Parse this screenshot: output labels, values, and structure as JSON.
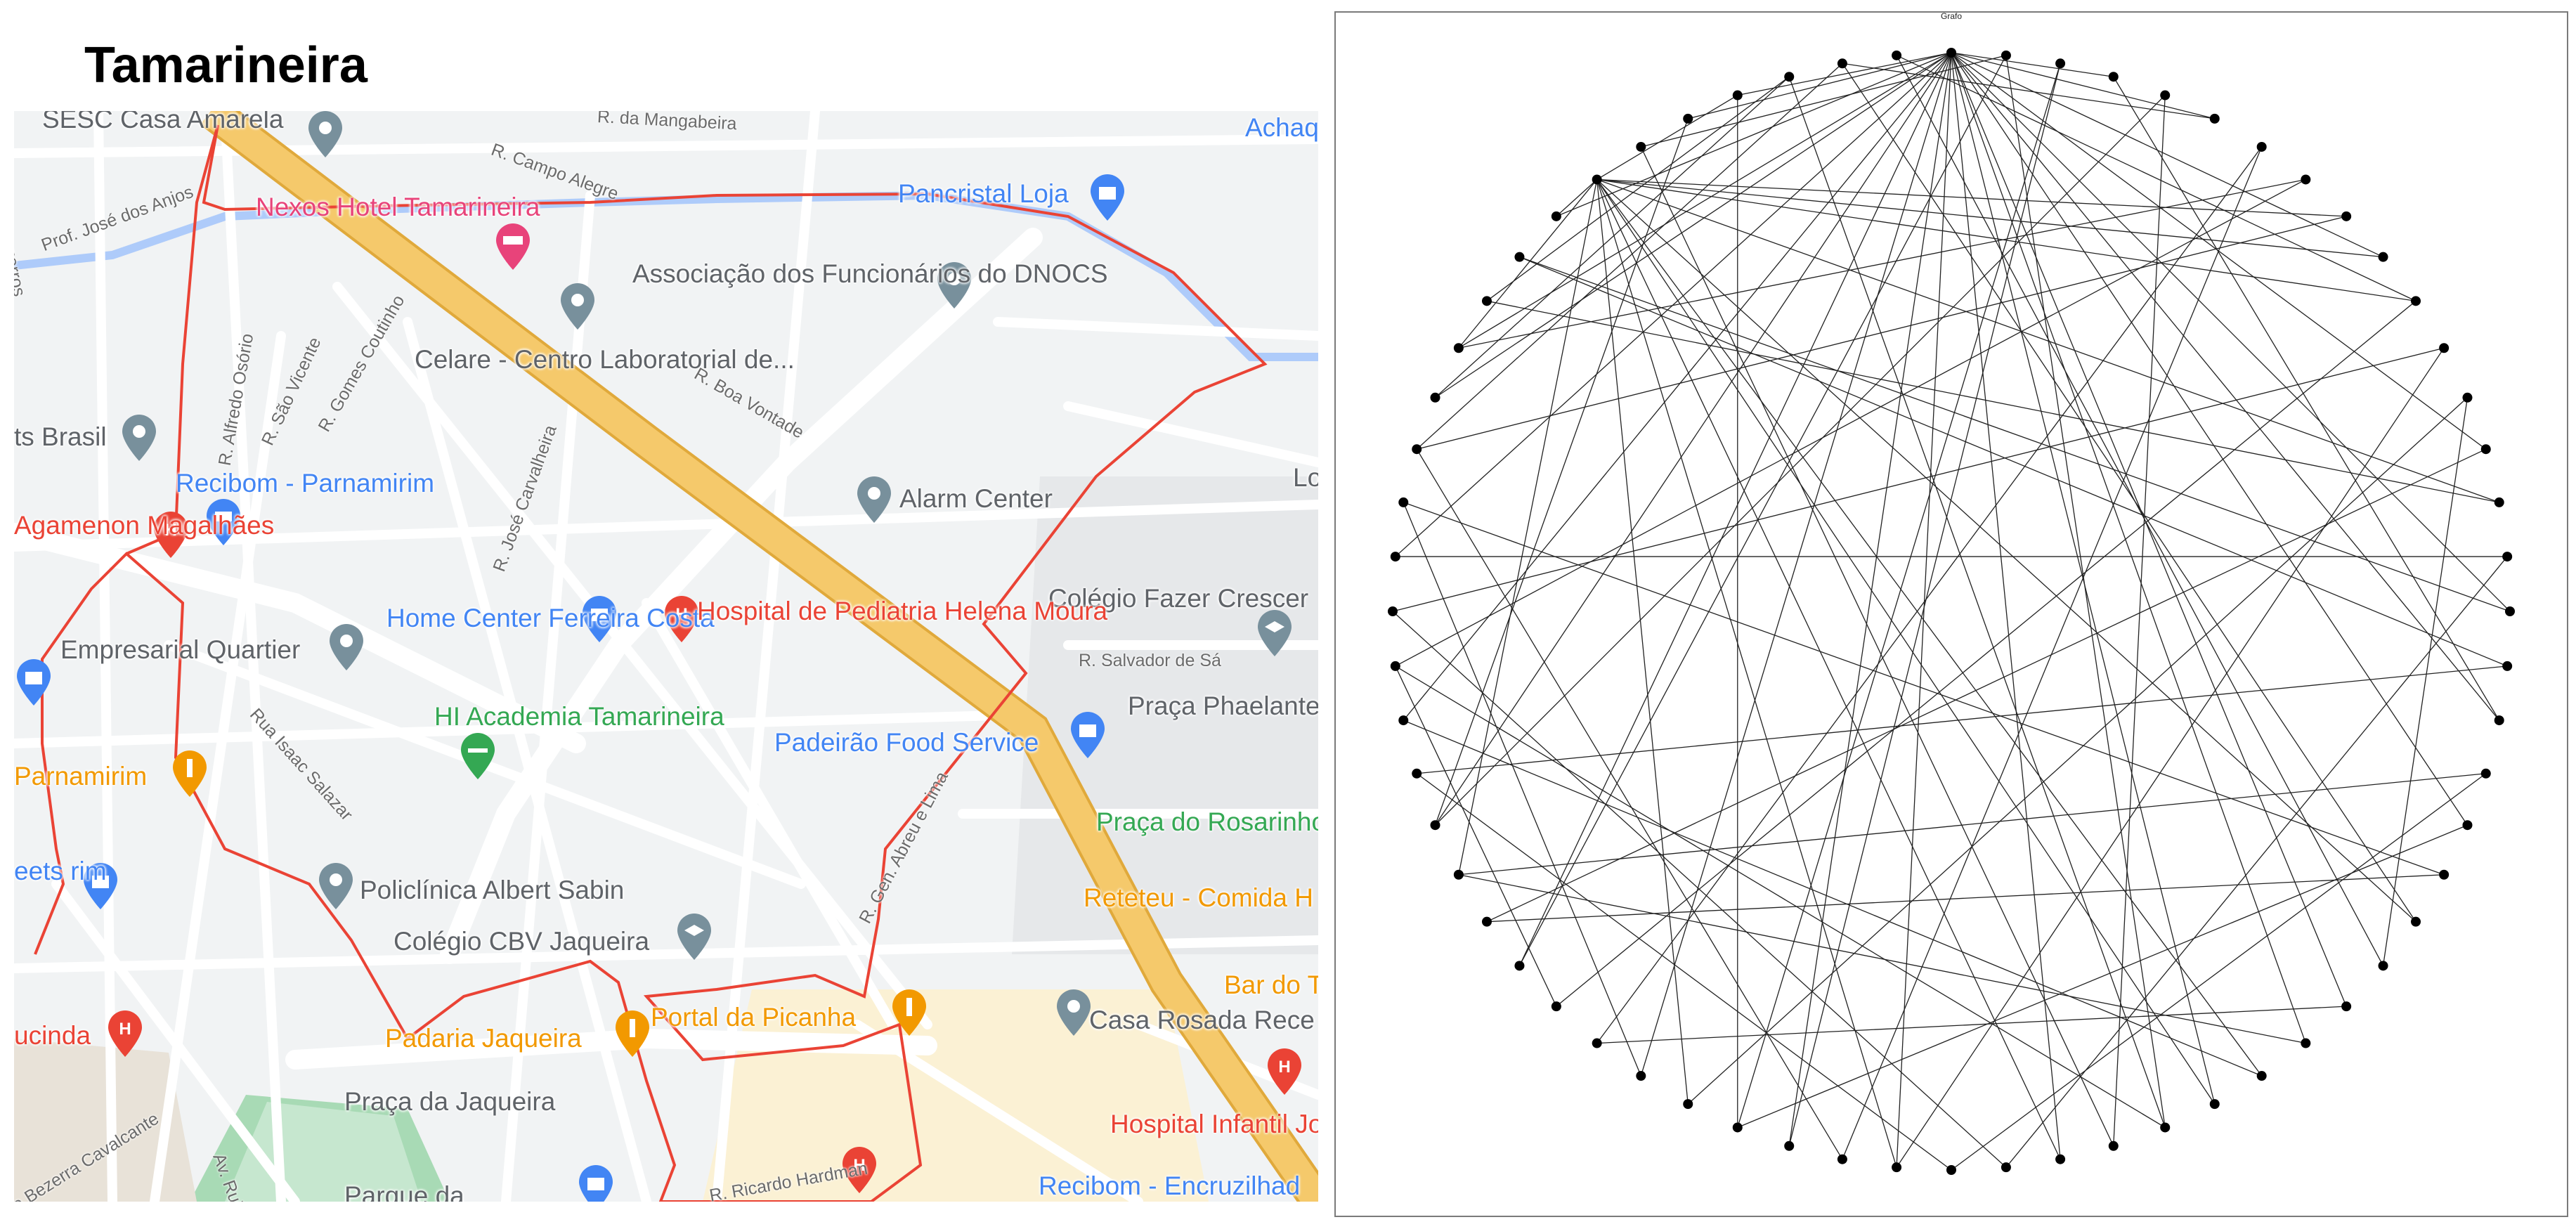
{
  "map": {
    "title": "Tamarineira",
    "colors": {
      "background": "#f1f3f4",
      "road": "#ffffff",
      "highway": "#f5c96b",
      "highway_edge": "#e0a93b",
      "river": "#aecbfa",
      "boundary": "#ea4335",
      "park": "#a8dab5",
      "sand": "#fbf1d4",
      "poi_generic": "#78909c",
      "poi_health": "#ea4335",
      "poi_food": "#f29900",
      "poi_shop": "#4285f4",
      "poi_park": "#34a853",
      "poi_hotel": "#e8437a"
    },
    "places": [
      {
        "name": "SESC Casa Amarela",
        "category": "generic",
        "icon": "map-pin-icon"
      },
      {
        "name": "Nexos Hotel Tamarineira",
        "category": "hotel",
        "icon": "bed-icon"
      },
      {
        "name": "Pancristal Loja",
        "category": "shop",
        "icon": "shopping-bag-icon"
      },
      {
        "name": "Achaq",
        "category": "shop",
        "icon": ""
      },
      {
        "name": "Associação dos Funcionários do DNOCS",
        "category": "generic",
        "icon": "map-pin-icon"
      },
      {
        "name": "Celare - Centro Laboratorial de...",
        "category": "generic",
        "icon": "map-pin-icon"
      },
      {
        "name": "ts Brasil",
        "category": "generic",
        "icon": "map-pin-icon"
      },
      {
        "name": "Recibom - Parnamirim",
        "category": "shop",
        "icon": "shopping-cart-icon"
      },
      {
        "name": "Agamenon Magalhães",
        "category": "health",
        "icon": "hospital-icon"
      },
      {
        "name": "Alarm Center",
        "category": "generic",
        "icon": "map-pin-icon"
      },
      {
        "name": "Lo",
        "category": "generic",
        "icon": ""
      },
      {
        "name": "Colégio Fazer Crescer",
        "category": "generic",
        "icon": "graduation-cap-icon"
      },
      {
        "name": "Home Center Ferreira Costa",
        "category": "shop",
        "icon": "shopping-bag-icon"
      },
      {
        "name": "Hospital de Pediatria Helena Moura",
        "category": "health",
        "icon": "hospital-icon"
      },
      {
        "name": "Empresarial Quartier",
        "category": "generic",
        "icon": "map-pin-icon"
      },
      {
        "name": "HI Academia Tamarineira",
        "category": "park",
        "icon": "dumbbell-icon"
      },
      {
        "name": "Padeirão Food Service",
        "category": "shop",
        "icon": "shopping-bag-icon"
      },
      {
        "name": "Praça Phaelante da Câmara",
        "category": "generic",
        "icon": ""
      },
      {
        "name": "Parnamirim",
        "category": "food",
        "icon": "fork-knife-icon"
      },
      {
        "name": "Praça do Rosarinho",
        "category": "park",
        "icon": ""
      },
      {
        "name": "Reteteu - Comida H",
        "category": "food",
        "icon": ""
      },
      {
        "name": "eets rim",
        "category": "shop",
        "icon": "shopping-bag-icon"
      },
      {
        "name": "Policlínica Albert Sabin",
        "category": "generic",
        "icon": "map-pin-icon"
      },
      {
        "name": "Colégio CBV Jaqueira",
        "category": "generic",
        "icon": "graduation-cap-icon"
      },
      {
        "name": "Bar do T",
        "category": "food",
        "icon": ""
      },
      {
        "name": "ucinda",
        "category": "health",
        "icon": "hospital-icon"
      },
      {
        "name": "Padaria Jaqueira",
        "category": "food",
        "icon": "fork-knife-icon"
      },
      {
        "name": "Portal da Picanha",
        "category": "food",
        "icon": "fork-knife-icon"
      },
      {
        "name": "Casa Rosada Rece",
        "category": "generic",
        "icon": "map-pin-icon"
      },
      {
        "name": "Praça da Jaqueira",
        "category": "generic",
        "icon": ""
      },
      {
        "name": "Hospital Infantil Jorge de Medeiros",
        "category": "health",
        "icon": "hospital-icon"
      },
      {
        "name": "Recibom - Encruzilhad",
        "category": "shop",
        "icon": ""
      },
      {
        "name": "Parque da",
        "category": "generic",
        "icon": ""
      }
    ],
    "streets": [
      "R. da Mangabeira",
      "R. Campo Alegre",
      "R. Bezerros",
      "Prof. José dos Anjos",
      "R. Alfredo Osório",
      "R. São Vicente",
      "R. Gomes Coutinho",
      "R. Boa Vontade",
      "R. José Carvalheira",
      "Rua Isaac Salazar",
      "R. Salvador de Sá",
      "R. Gen. Abreu e Lima",
      "R. Ricardo Hardman",
      "Av. Rui B",
      "o Bezerra Cavalcante"
    ]
  },
  "graph": {
    "title": "Grafo",
    "node_count": 64,
    "edges": [
      [
        0,
        9
      ],
      [
        0,
        52
      ],
      [
        0,
        38
      ],
      [
        0,
        27
      ],
      [
        0,
        33
      ],
      [
        0,
        44
      ],
      [
        0,
        49
      ],
      [
        0,
        56
      ],
      [
        0,
        30
      ],
      [
        0,
        20
      ],
      [
        0,
        46
      ],
      [
        0,
        41
      ],
      [
        0,
        35
      ],
      [
        0,
        60
      ],
      [
        0,
        53
      ],
      [
        0,
        25
      ],
      [
        0,
        24
      ],
      [
        0,
        18
      ],
      [
        0,
        16
      ],
      [
        0,
        59
      ],
      [
        0,
        5
      ],
      [
        0,
        13
      ],
      [
        0,
        3
      ],
      [
        57,
        9
      ],
      [
        57,
        14
      ],
      [
        57,
        22
      ],
      [
        57,
        27
      ],
      [
        57,
        30
      ],
      [
        57,
        33
      ],
      [
        57,
        43
      ],
      [
        57,
        37
      ],
      [
        57,
        26
      ],
      [
        57,
        8
      ],
      [
        57,
        60
      ],
      [
        57,
        10
      ],
      [
        57,
        53
      ],
      [
        57,
        56
      ],
      [
        1,
        28
      ],
      [
        2,
        36
      ],
      [
        4,
        29
      ],
      [
        5,
        62
      ],
      [
        6,
        34
      ],
      [
        7,
        47
      ],
      [
        8,
        51
      ],
      [
        10,
        40
      ],
      [
        11,
        33
      ],
      [
        12,
        23
      ],
      [
        13,
        42
      ],
      [
        14,
        54
      ],
      [
        15,
        31
      ],
      [
        16,
        55
      ],
      [
        17,
        45
      ],
      [
        18,
        3
      ],
      [
        19,
        32
      ],
      [
        21,
        50
      ],
      [
        23,
        63
      ],
      [
        24,
        39
      ],
      [
        26,
        46
      ],
      [
        28,
        61
      ],
      [
        29,
        58
      ],
      [
        31,
        48
      ],
      [
        32,
        45
      ],
      [
        34,
        51
      ],
      [
        35,
        2
      ],
      [
        36,
        20
      ],
      [
        37,
        12
      ],
      [
        38,
        50
      ],
      [
        39,
        6
      ],
      [
        40,
        47
      ],
      [
        41,
        1
      ],
      [
        42,
        21
      ],
      [
        43,
        19
      ],
      [
        44,
        4
      ],
      [
        47,
        28
      ],
      [
        48,
        11
      ],
      [
        49,
        15
      ],
      [
        51,
        62
      ],
      [
        53,
        7
      ],
      [
        54,
        61
      ],
      [
        55,
        17
      ],
      [
        58,
        1
      ],
      [
        59,
        44
      ],
      [
        60,
        36
      ],
      [
        61,
        52
      ],
      [
        62,
        22
      ],
      [
        63,
        10
      ],
      [
        25,
        43
      ]
    ]
  }
}
